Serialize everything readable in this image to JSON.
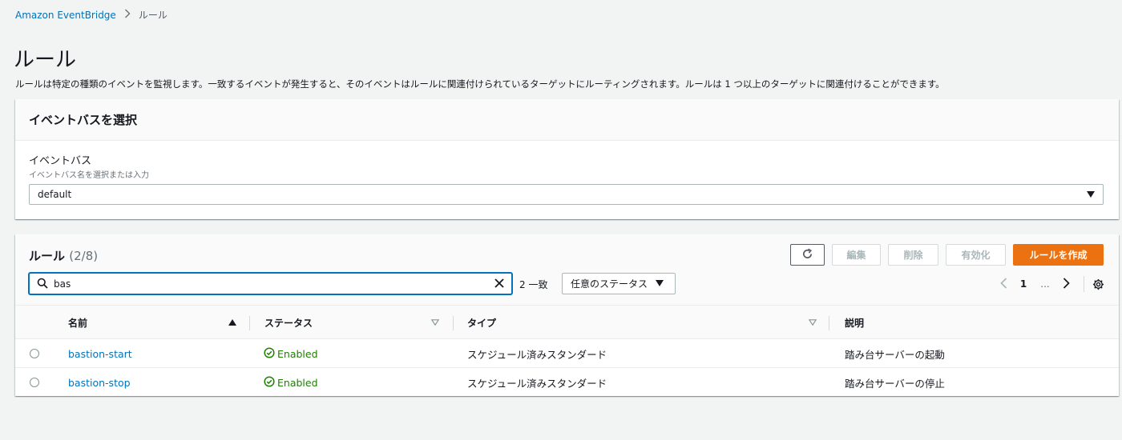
{
  "breadcrumb": {
    "root": "Amazon EventBridge",
    "current": "ルール"
  },
  "page": {
    "title": "ルール",
    "description": "ルールは特定の種類のイベントを監視します。一致するイベントが発生すると、そのイベントはルールに関連付けられているターゲットにルーティングされます。ルールは 1 つ以上のターゲットに関連付けることができます。"
  },
  "event_bus_panel": {
    "header": "イベントバスを選択",
    "label": "イベントバス",
    "description": "イベントバス名を選択または入力",
    "selected": "default"
  },
  "rules": {
    "title": "ルール",
    "count": "(2/8)",
    "buttons": {
      "edit": "編集",
      "delete": "削除",
      "enable": "有効化",
      "create": "ルールを作成"
    },
    "search": {
      "value": "bas",
      "match_count": "2 一致"
    },
    "status_filter": "任意のステータス",
    "pagination": {
      "page": "1",
      "ellipsis": "..."
    },
    "columns": {
      "name": "名前",
      "status": "ステータス",
      "type": "タイプ",
      "description": "説明"
    },
    "rows": [
      {
        "name": "bastion-start",
        "status": "Enabled",
        "type": "スケジュール済みスタンダード",
        "description": "踏み台サーバーの起動"
      },
      {
        "name": "bastion-stop",
        "status": "Enabled",
        "type": "スケジュール済みスタンダード",
        "description": "踏み台サーバーの停止"
      }
    ]
  },
  "colors": {
    "link": "#0073bb",
    "primary_button": "#ec7211",
    "success": "#1d8102",
    "background": "#f2f3f3"
  },
  "icons": [
    "chevron-right-icon",
    "caret-down-icon",
    "refresh-icon",
    "search-icon",
    "close-icon",
    "sort-ascending-icon",
    "sort-descending-icon",
    "chevron-left-icon",
    "settings-icon",
    "check-circle-icon"
  ]
}
